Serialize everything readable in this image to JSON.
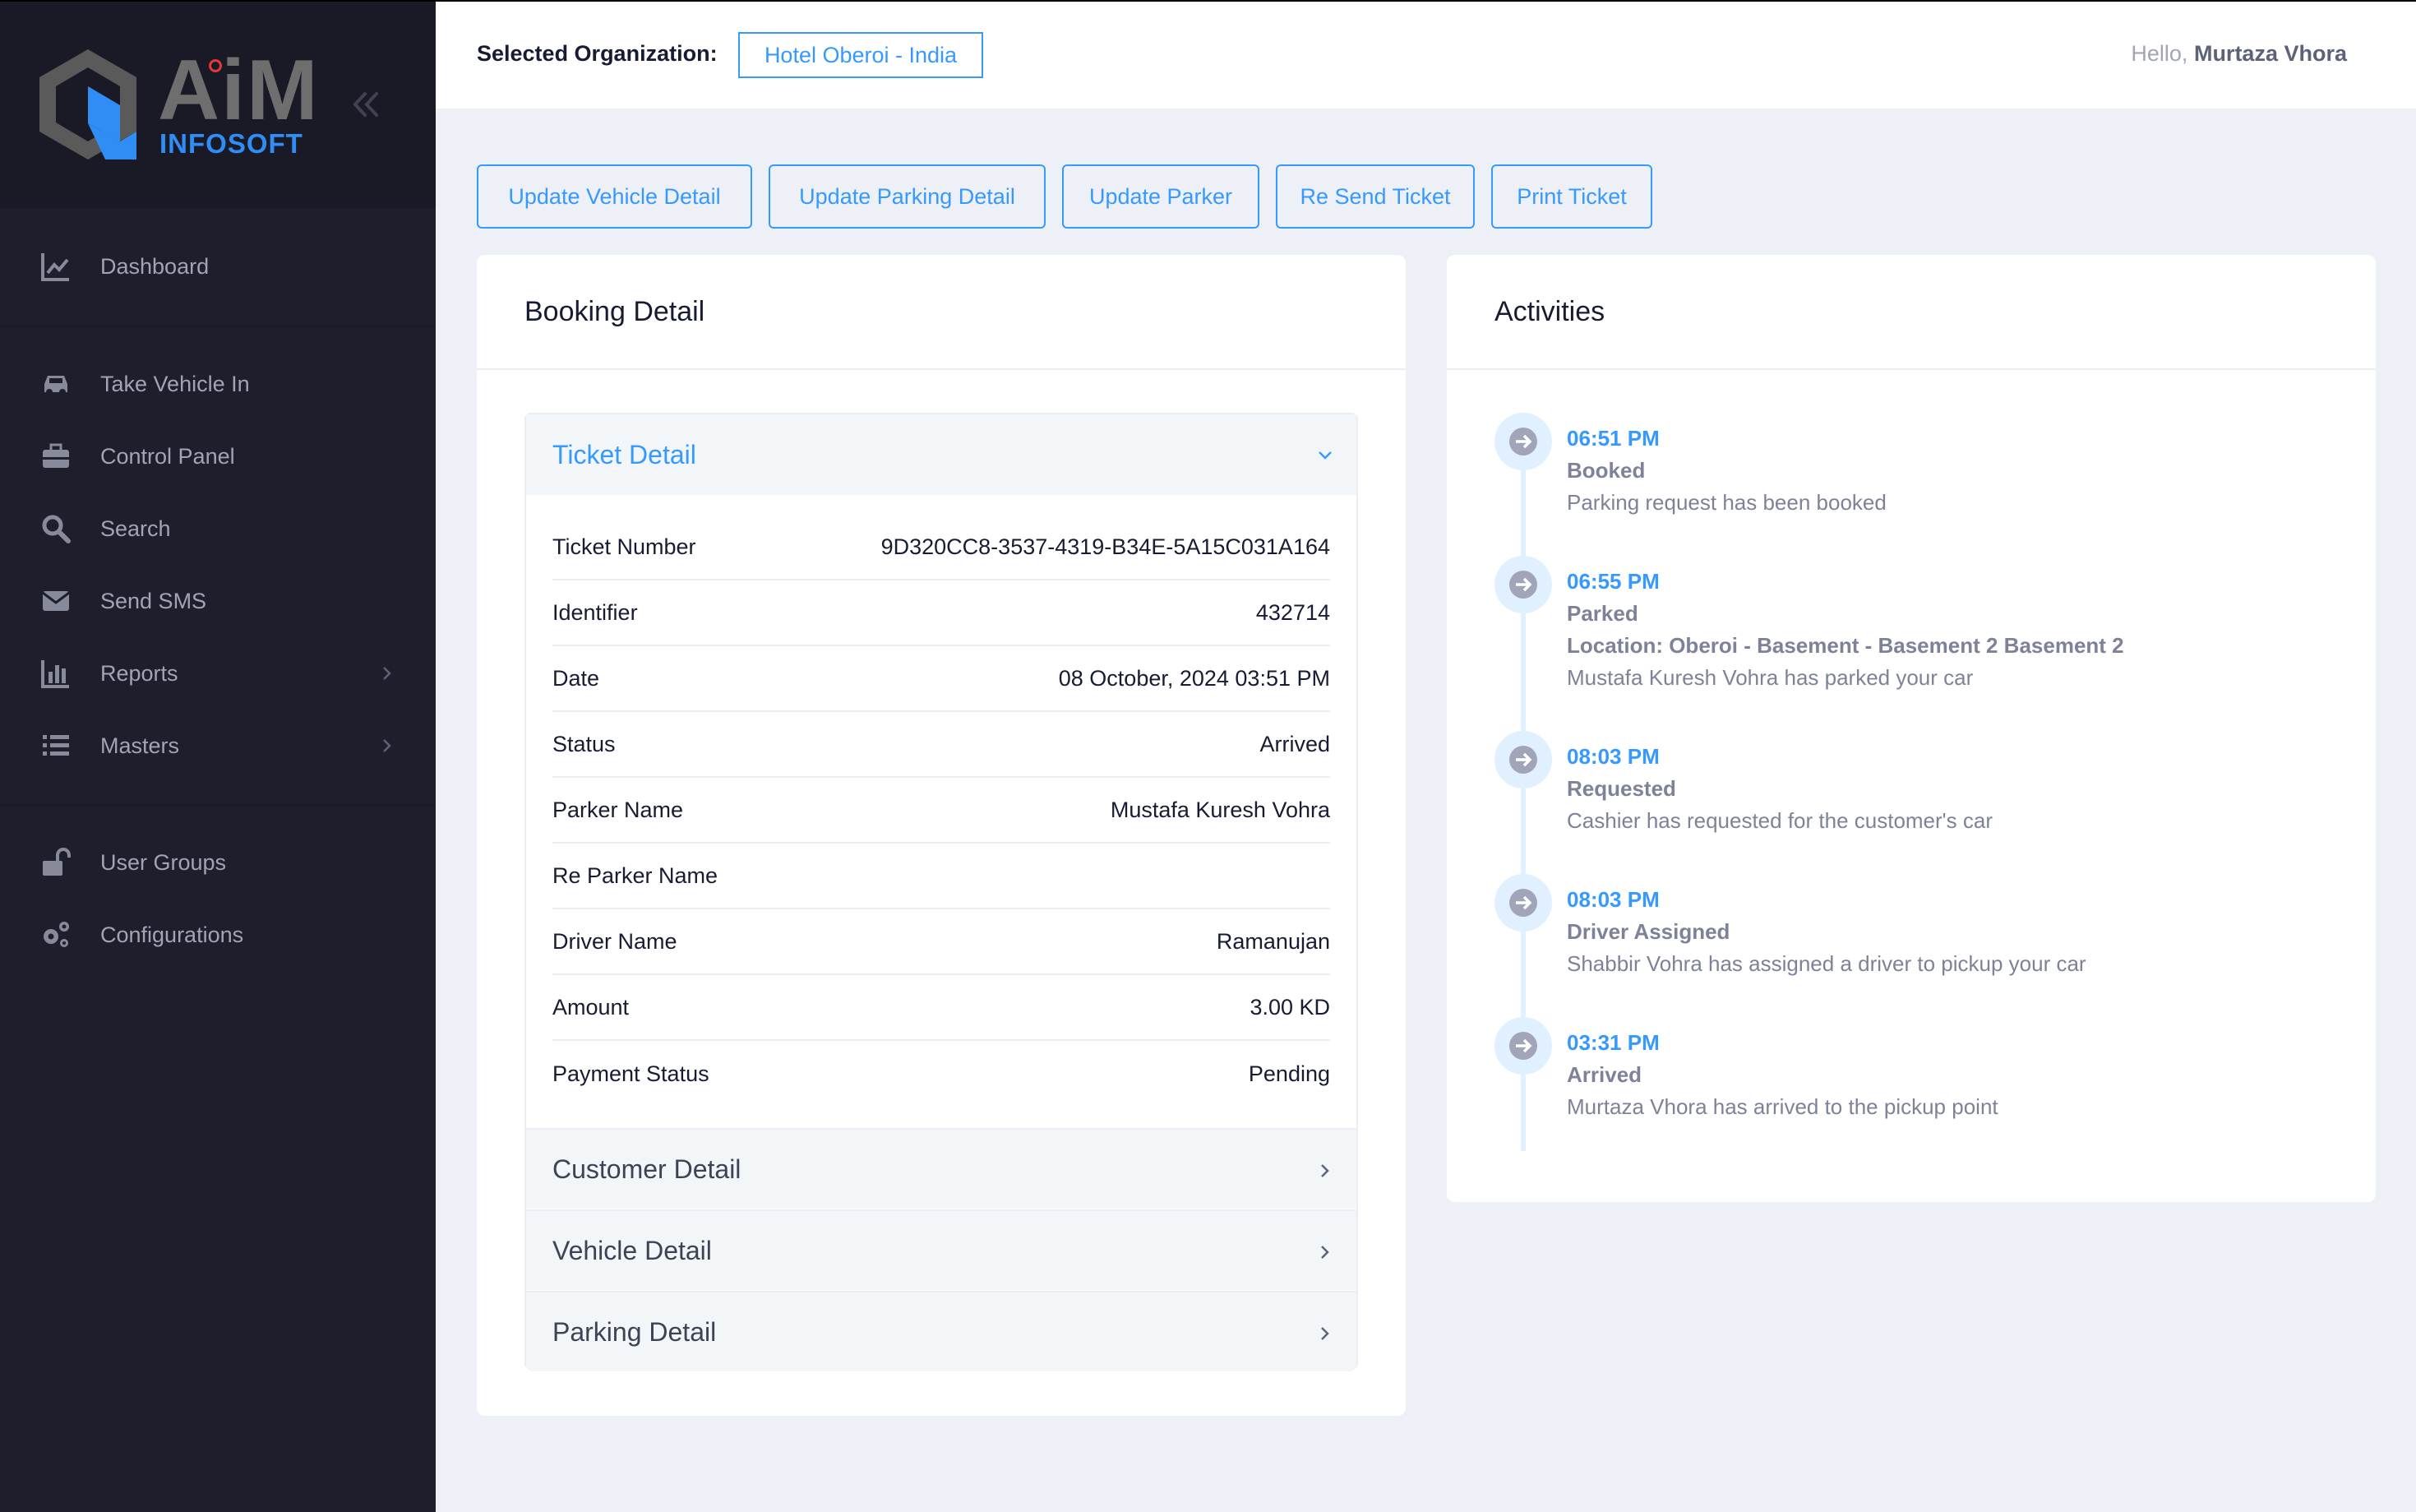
{
  "brand": {
    "name": "AiM",
    "sub": "INFOSOFT"
  },
  "sidebar": {
    "items": [
      {
        "label": "Dashboard",
        "icon": "chart-line-icon"
      },
      {
        "label": "Take Vehicle In",
        "icon": "car-icon"
      },
      {
        "label": "Control Panel",
        "icon": "toolbox-icon"
      },
      {
        "label": "Search",
        "icon": "search-icon"
      },
      {
        "label": "Send SMS",
        "icon": "envelope-icon"
      },
      {
        "label": "Reports",
        "icon": "bar-chart-icon"
      },
      {
        "label": "Masters",
        "icon": "list-icon"
      },
      {
        "label": "User Groups",
        "icon": "unlock-icon"
      },
      {
        "label": "Configurations",
        "icon": "gears-icon"
      }
    ]
  },
  "header": {
    "org_label": "Selected Organization:",
    "org_value": "Hotel Oberoi - India",
    "greeting": "Hello,",
    "user": "Murtaza Vhora"
  },
  "actions": {
    "update_vehicle": "Update Vehicle Detail",
    "update_parking": "Update Parking Detail",
    "update_parker": "Update Parker",
    "resend_ticket": "Re Send Ticket",
    "print_ticket": "Print Ticket"
  },
  "booking": {
    "title": "Booking Detail",
    "ticket_section": "Ticket Detail",
    "rows": [
      {
        "label": "Ticket Number",
        "value": "9D320CC8-3537-4319-B34E-5A15C031A164"
      },
      {
        "label": "Identifier",
        "value": "432714"
      },
      {
        "label": "Date",
        "value": "08 October, 2024 03:51 PM"
      },
      {
        "label": "Status",
        "value": "Arrived"
      },
      {
        "label": "Parker Name",
        "value": "Mustafa Kuresh Vohra"
      },
      {
        "label": "Re Parker Name",
        "value": ""
      },
      {
        "label": "Driver Name",
        "value": "Ramanujan"
      },
      {
        "label": "Amount",
        "value": "3.00 KD"
      },
      {
        "label": "Payment Status",
        "value": "Pending"
      }
    ],
    "customer_section": "Customer Detail",
    "vehicle_section": "Vehicle Detail",
    "parking_section": "Parking Detail"
  },
  "activities": {
    "title": "Activities",
    "items": [
      {
        "time": "06:51 PM",
        "title": "Booked",
        "location": "",
        "desc": "Parking request has been booked"
      },
      {
        "time": "06:55 PM",
        "title": "Parked",
        "location": "Location: Oberoi - Basement - Basement 2 Basement 2",
        "desc": "Mustafa Kuresh Vohra has parked your car"
      },
      {
        "time": "08:03 PM",
        "title": "Requested",
        "location": "",
        "desc": "Cashier has requested for the customer's car"
      },
      {
        "time": "08:03 PM",
        "title": "Driver Assigned",
        "location": "",
        "desc": "Shabbir Vohra has assigned a driver to pickup your car"
      },
      {
        "time": "03:31 PM",
        "title": "Arrived",
        "location": "",
        "desc": "Murtaza Vhora has arrived to the pickup point"
      }
    ]
  },
  "colors": {
    "accent": "#3699ff",
    "sidebar": "#1e1e2d",
    "background": "#eef0f8"
  }
}
